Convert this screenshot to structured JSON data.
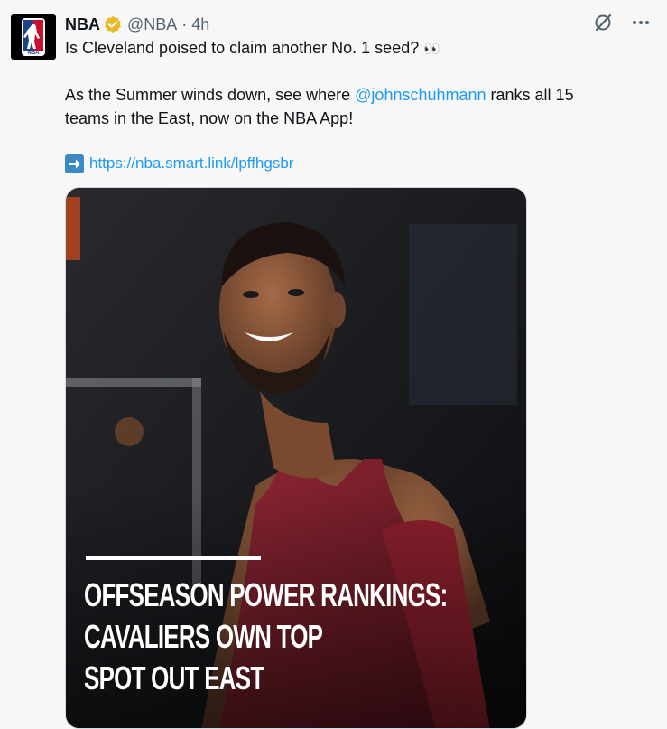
{
  "author": {
    "name": "NBA",
    "handle": "@NBA",
    "separator": "·",
    "time": "4h",
    "avatar_icon": "nba-logo-icon",
    "verified_icon": "gold-verified-badge-icon"
  },
  "tweet": {
    "line1_text": "Is Cleveland poised to claim another No. 1 seed?",
    "line1_emoji": "👀",
    "line2_before": "As the Summer winds down, see where ",
    "mention": "@johnschuhmann",
    "line2_after": " ranks all 15",
    "line3": "teams in the East, now on the NBA App!",
    "link_icon": "right-arrow-emoji-icon",
    "link": "https://nba.smart.link/lpffhgsbr"
  },
  "actions": {
    "grok_icon": "grok-icon",
    "more_icon": "more-horizontal-icon"
  },
  "media": {
    "headline_lines": [
      "Offseason Power Rankings:",
      "Cavaliers Own Top",
      "Spot Out East"
    ]
  },
  "colors": {
    "link": "#1d9bf0",
    "jersey": "#7e1f2a",
    "badge": "#f4c430"
  }
}
